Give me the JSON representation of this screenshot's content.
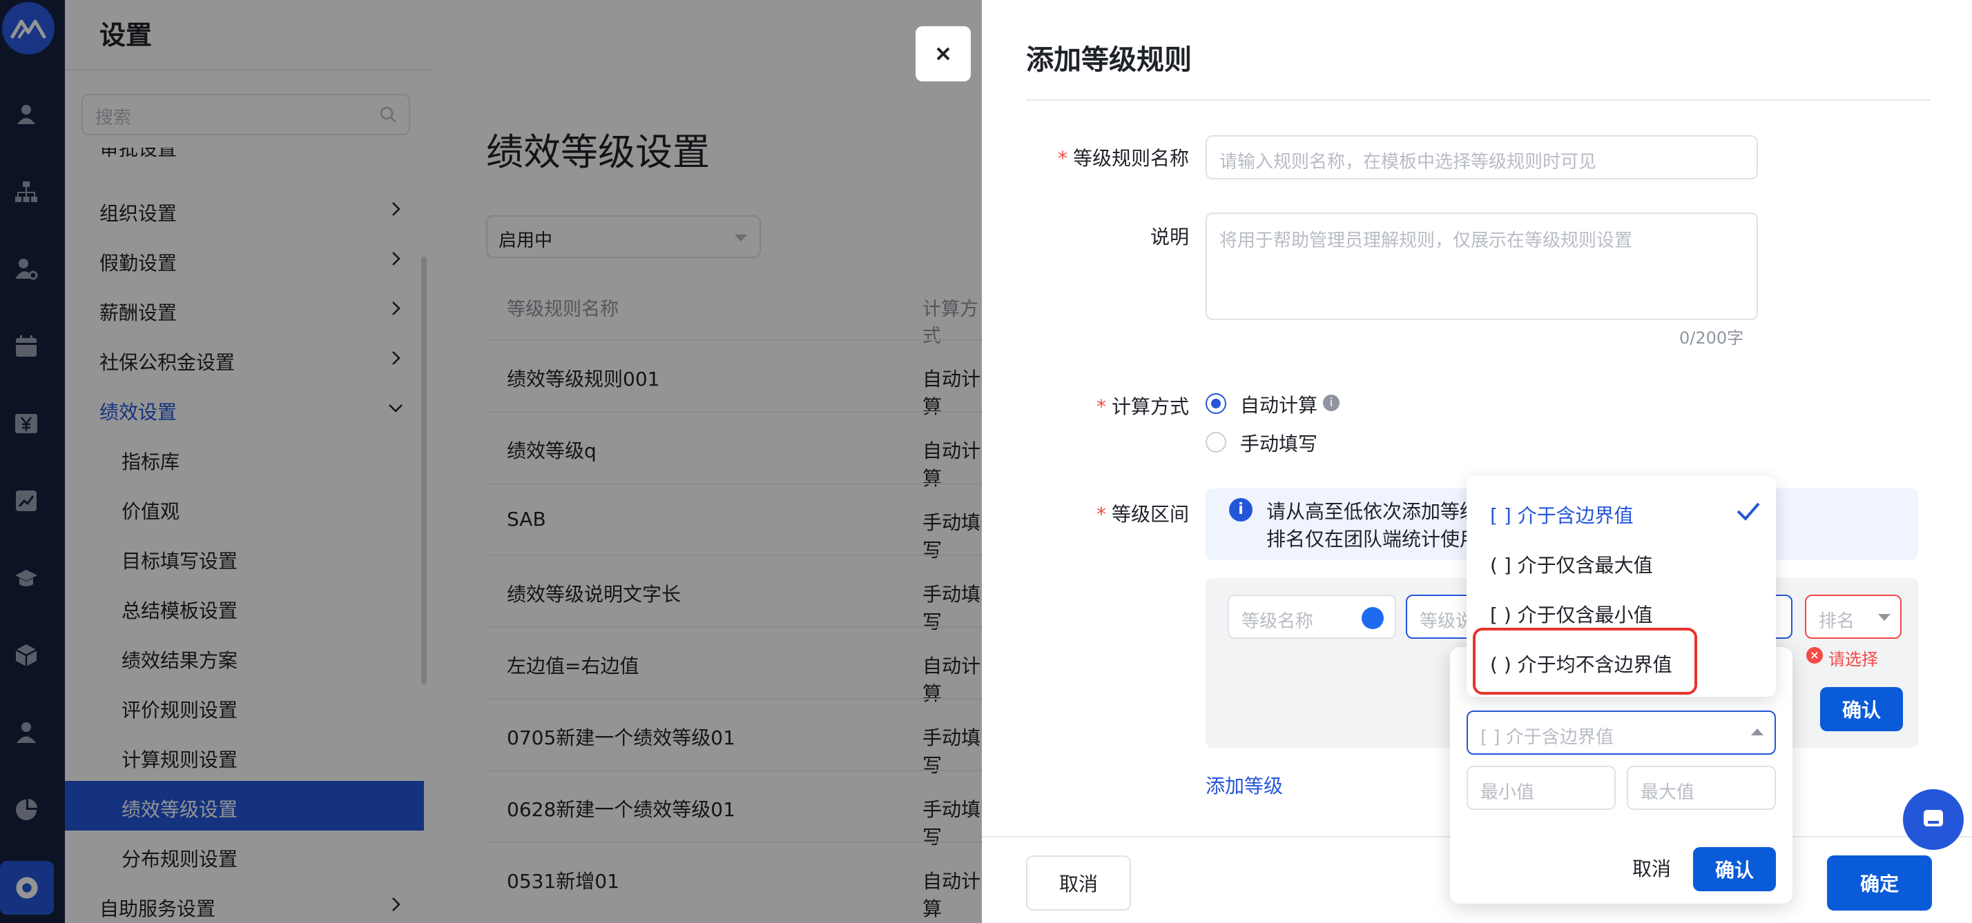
{
  "leftnav": {
    "title": "设置",
    "search_placeholder": "搜索",
    "partial_item": "审批设置",
    "items": [
      {
        "label": "组织设置",
        "type": "group"
      },
      {
        "label": "假勤设置",
        "type": "group"
      },
      {
        "label": "薪酬设置",
        "type": "group"
      },
      {
        "label": "社保公积金设置",
        "type": "group"
      },
      {
        "label": "绩效设置",
        "type": "expanded"
      },
      {
        "label": "指标库",
        "type": "child"
      },
      {
        "label": "价值观",
        "type": "child"
      },
      {
        "label": "目标填写设置",
        "type": "child"
      },
      {
        "label": "总结模板设置",
        "type": "child"
      },
      {
        "label": "绩效结果方案",
        "type": "child"
      },
      {
        "label": "评价规则设置",
        "type": "child"
      },
      {
        "label": "计算规则设置",
        "type": "child"
      },
      {
        "label": "绩效等级设置",
        "type": "active"
      },
      {
        "label": "分布规则设置",
        "type": "child"
      },
      {
        "label": "自助服务设置",
        "type": "group"
      }
    ]
  },
  "main": {
    "title": "绩效等级设置",
    "status_select": "启用中",
    "columns": [
      "等级规则名称",
      "计算方式"
    ],
    "rows": [
      {
        "name": "绩效等级规则001",
        "calc": "自动计算"
      },
      {
        "name": "绩效等级q",
        "calc": "自动计算"
      },
      {
        "name": "SAB",
        "calc": "手动填写"
      },
      {
        "name": "绩效等级说明文字长",
        "calc": "手动填写"
      },
      {
        "name": "左边值=右边值",
        "calc": "自动计算"
      },
      {
        "name": "0705新建一个绩效等级01",
        "calc": "手动填写"
      },
      {
        "name": "0628新建一个绩效等级01",
        "calc": "手动填写"
      },
      {
        "name": "0531新增01",
        "calc": "自动计算"
      }
    ]
  },
  "drawer": {
    "title": "添加等级规则",
    "name_label": "等级规则名称",
    "name_placeholder": "请输入规则名称，在模板中选择等级规则时可见",
    "desc_label": "说明",
    "desc_placeholder": "将用于帮助管理员理解规则，仅展示在等级规则设置",
    "desc_counter": "0/200字",
    "calc_label": "计算方式",
    "calc_options": [
      "自动计算",
      "手动填写"
    ],
    "range_label": "等级区间",
    "info_line1": "请从高至低依次添加等级",
    "info_line2": "排名仅在团队端统计使用",
    "level_name_placeholder": "等级名称",
    "level_desc_placeholder": "等级说明",
    "rank_placeholder": "排名",
    "rank_error": "请选择",
    "row_confirm": "确认",
    "add_level": "添加等级",
    "cancel": "取消",
    "ok": "确定"
  },
  "popover": {
    "select_value": "[ ] 介于含边界值",
    "min_placeholder": "最小值",
    "max_placeholder": "最大值",
    "cancel": "取消",
    "confirm": "确认"
  },
  "dropdown": {
    "options": [
      "[ ] 介于含边界值",
      "( ] 介于仅含最大值",
      "[ ) 介于仅含最小值",
      "( ) 介于均不含边界值"
    ],
    "selected_index": 0
  },
  "colors": {
    "primary": "#2456d9",
    "rail": "#16223e",
    "danger": "#f54a45"
  }
}
